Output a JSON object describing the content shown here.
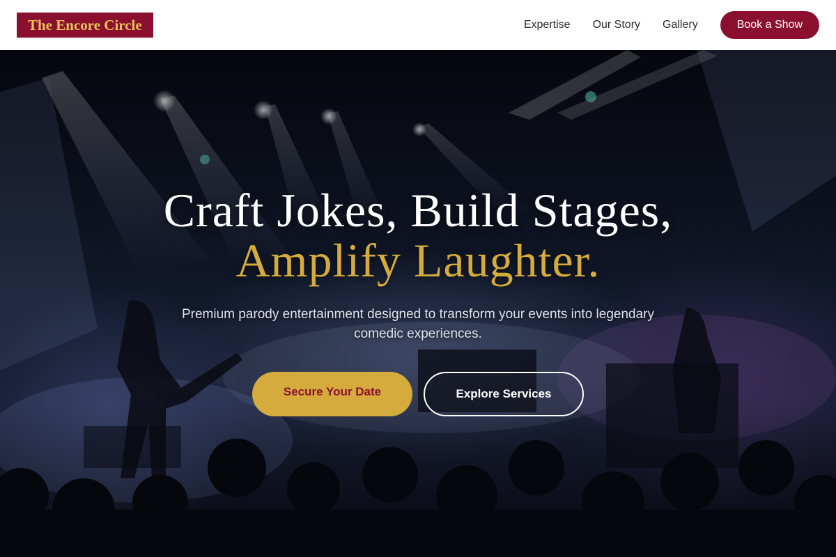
{
  "brand": {
    "name": "The Encore Circle"
  },
  "nav": {
    "links": [
      {
        "label": "Expertise"
      },
      {
        "label": "Our Story"
      },
      {
        "label": "Gallery"
      }
    ],
    "cta_label": "Book a Show"
  },
  "hero": {
    "headline_line1": "Craft Jokes, Build Stages,",
    "headline_line2": "Amplify Laughter.",
    "subtitle": "Premium parody entertainment designed to transform your events into legendary comedic experiences.",
    "primary_button": "Secure Your Date",
    "secondary_button": "Explore Services"
  },
  "colors": {
    "brand_burgundy": "#8b1030",
    "accent_gold": "#d4ab3c",
    "nav_background": "#ffffff"
  }
}
